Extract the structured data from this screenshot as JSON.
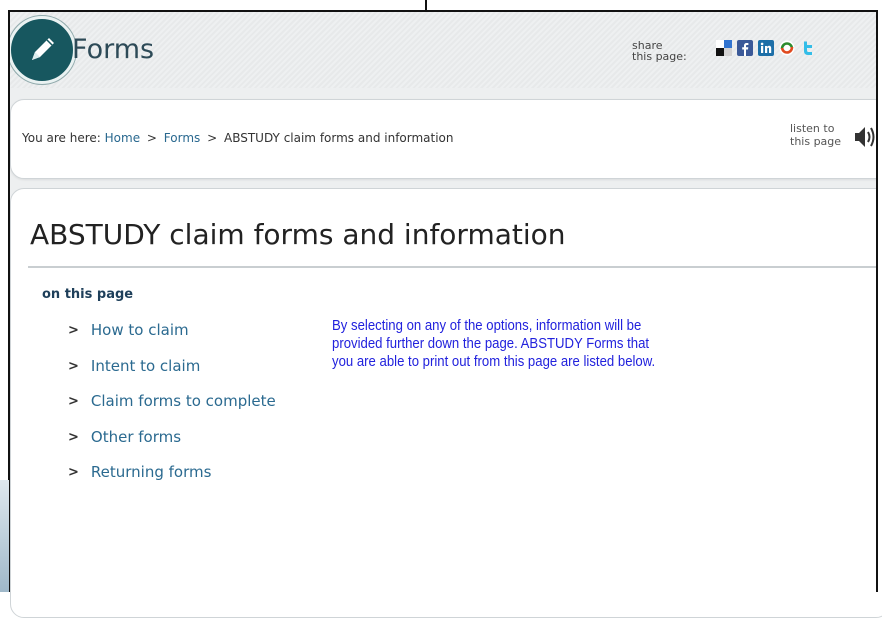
{
  "header": {
    "title": "Forms",
    "share_label_line1": "share",
    "share_label_line2": "this page:",
    "share_icons": [
      "delicious-icon",
      "facebook-icon",
      "linkedin-icon",
      "stumbleupon-icon",
      "twitter-icon"
    ]
  },
  "breadcrumb": {
    "prefix": "You are here:",
    "home": "Home",
    "sep1": ">",
    "forms": "Forms",
    "sep2": ">",
    "current": "ABSTUDY claim forms and information"
  },
  "listen": {
    "line1": "listen to",
    "line2": "this page"
  },
  "main": {
    "title": "ABSTUDY claim forms and information",
    "on_this_page": "on this page",
    "toc": [
      {
        "chevron": ">",
        "label": "How to claim"
      },
      {
        "chevron": ">",
        "label": "Intent to claim"
      },
      {
        "chevron": ">",
        "label": "Claim forms to complete"
      },
      {
        "chevron": ">",
        "label": "Other forms"
      },
      {
        "chevron": ">",
        "label": "Returning forms"
      }
    ],
    "intro": "By selecting on any of the options, information will be provided further down the page.  ABSTUDY Forms that you are able to print out from this page are listed below."
  },
  "colors": {
    "link": "#2b6a90",
    "intro_text": "#2222dd",
    "logo_bg": "#17575f",
    "header_title": "#2d4a57"
  }
}
